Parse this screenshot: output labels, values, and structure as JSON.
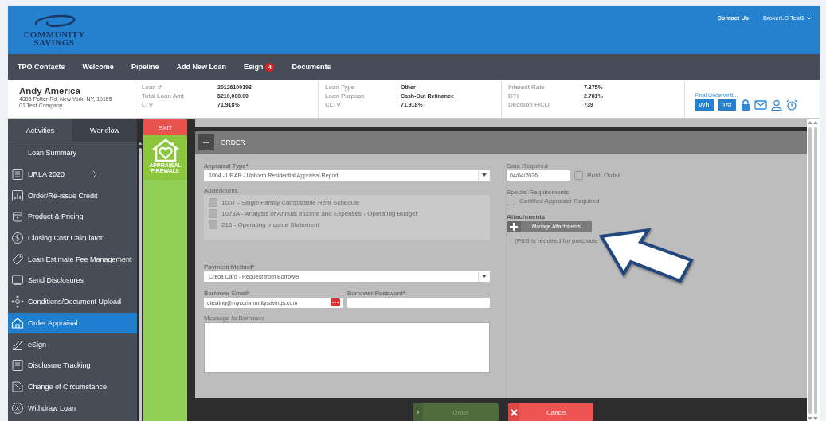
{
  "header": {
    "logo_lines": [
      "COMMUNITY",
      "SAVINGS"
    ],
    "links": [
      "Contact Us"
    ],
    "user": "BrokerLO Test1"
  },
  "nav": [
    {
      "label": "TPO Contacts"
    },
    {
      "label": "Welcome"
    },
    {
      "label": "Pipeline"
    },
    {
      "label": "Add New Loan"
    },
    {
      "label": "Esign",
      "badge": "4"
    },
    {
      "label": "Documents"
    }
  ],
  "borrower": {
    "name": "Andy America",
    "address": "4885 Potter Rd, New York, NY, 10155",
    "company": "01 Test Company"
  },
  "loan_info": [
    [
      {
        "label": "Loan #",
        "value": "20126100193"
      },
      {
        "label": "Total Loan Amt",
        "value": "$210,000.00"
      },
      {
        "label": "LTV",
        "value": "71.918%"
      }
    ],
    [
      {
        "label": "Loan Type",
        "value": "Other"
      },
      {
        "label": "Loan Purpose",
        "value": "Cash-Out Refinance"
      },
      {
        "label": "CLTV",
        "value": "71.918%"
      }
    ],
    [
      {
        "label": "Interest Rate",
        "value": "7.375%"
      },
      {
        "label": "DTI",
        "value": "2.781%"
      },
      {
        "label": "Decision FICO",
        "value": "739"
      }
    ]
  ],
  "status": {
    "link": "Final Underwriti...",
    "buttons": [
      "Wh",
      "1st"
    ]
  },
  "sidebar": {
    "tabs": [
      {
        "label": "Activities",
        "selected": false
      },
      {
        "label": "Workflow",
        "selected": true
      }
    ],
    "items": [
      {
        "label": "Loan Summary",
        "selected": false,
        "submenu": false
      },
      {
        "label": "URLA 2020",
        "selected": false,
        "submenu": true
      },
      {
        "label": "Order/Re-issue Credit",
        "selected": false,
        "submenu": false
      },
      {
        "label": "Product & Pricing",
        "selected": false,
        "submenu": false
      },
      {
        "label": "Closing Cost Calculator",
        "selected": false,
        "submenu": false
      },
      {
        "label": "Loan Estimate Fee Management",
        "selected": false,
        "submenu": false
      },
      {
        "label": "Send Disclosures",
        "selected": false,
        "submenu": false
      },
      {
        "label": "Conditions/Document Upload",
        "selected": false,
        "submenu": false
      },
      {
        "label": "Order Appraisal",
        "selected": true,
        "submenu": false
      },
      {
        "label": "eSign",
        "selected": false,
        "submenu": false
      },
      {
        "label": "Disclosure Tracking",
        "selected": false,
        "submenu": false
      },
      {
        "label": "Change of Circumstance",
        "selected": false,
        "submenu": false
      },
      {
        "label": "Withdraw Loan",
        "selected": false,
        "submenu": false
      }
    ]
  },
  "firewall": {
    "exit": "EXIT",
    "logo_lines": [
      "APPRAISAL",
      "FIREWALL"
    ]
  },
  "order": {
    "title": "ORDER",
    "appraisal_type": {
      "label": "Appraisal Type*",
      "value": "1004 - URAR - Uniform Residential Appraisal Report"
    },
    "addendums": {
      "label": "Addendums",
      "items": [
        {
          "label": "1007 - Single Family Comparable Rent Schedule",
          "checked": false,
          "disabled": true
        },
        {
          "label": "1073A - Analysis of Annual Income and Expenses - Operating Budget",
          "checked": false,
          "disabled": true
        },
        {
          "label": "216 - Operating Income Statement",
          "checked": false,
          "disabled": true
        }
      ]
    },
    "payment_method": {
      "label": "Payment Method*",
      "value": "Credit Card - Request from Borrower"
    },
    "borrower_email": {
      "label": "Borrower Email*",
      "value": "ctesting@mycommunitysavings.com"
    },
    "borrower_password": {
      "label": "Borrower Password*"
    },
    "message": {
      "label": "Message to Borrower"
    },
    "date_required": {
      "label": "Date Required",
      "value": "04/04/2026"
    },
    "rush_order": {
      "label": "Rush Order",
      "checked": false
    },
    "special": {
      "label": "Special Requirements",
      "option": {
        "label": "Certified Appraiser Required",
        "checked": false
      }
    },
    "attachments": {
      "label": "Attachments",
      "button": "Manage Attachments",
      "note": "(P&S is required for purchase"
    }
  },
  "footer": {
    "buttons": [
      {
        "label": "Order",
        "kind": "submit",
        "disabled": true
      },
      {
        "label": "Cancel",
        "kind": "cancel",
        "disabled": false
      }
    ]
  }
}
